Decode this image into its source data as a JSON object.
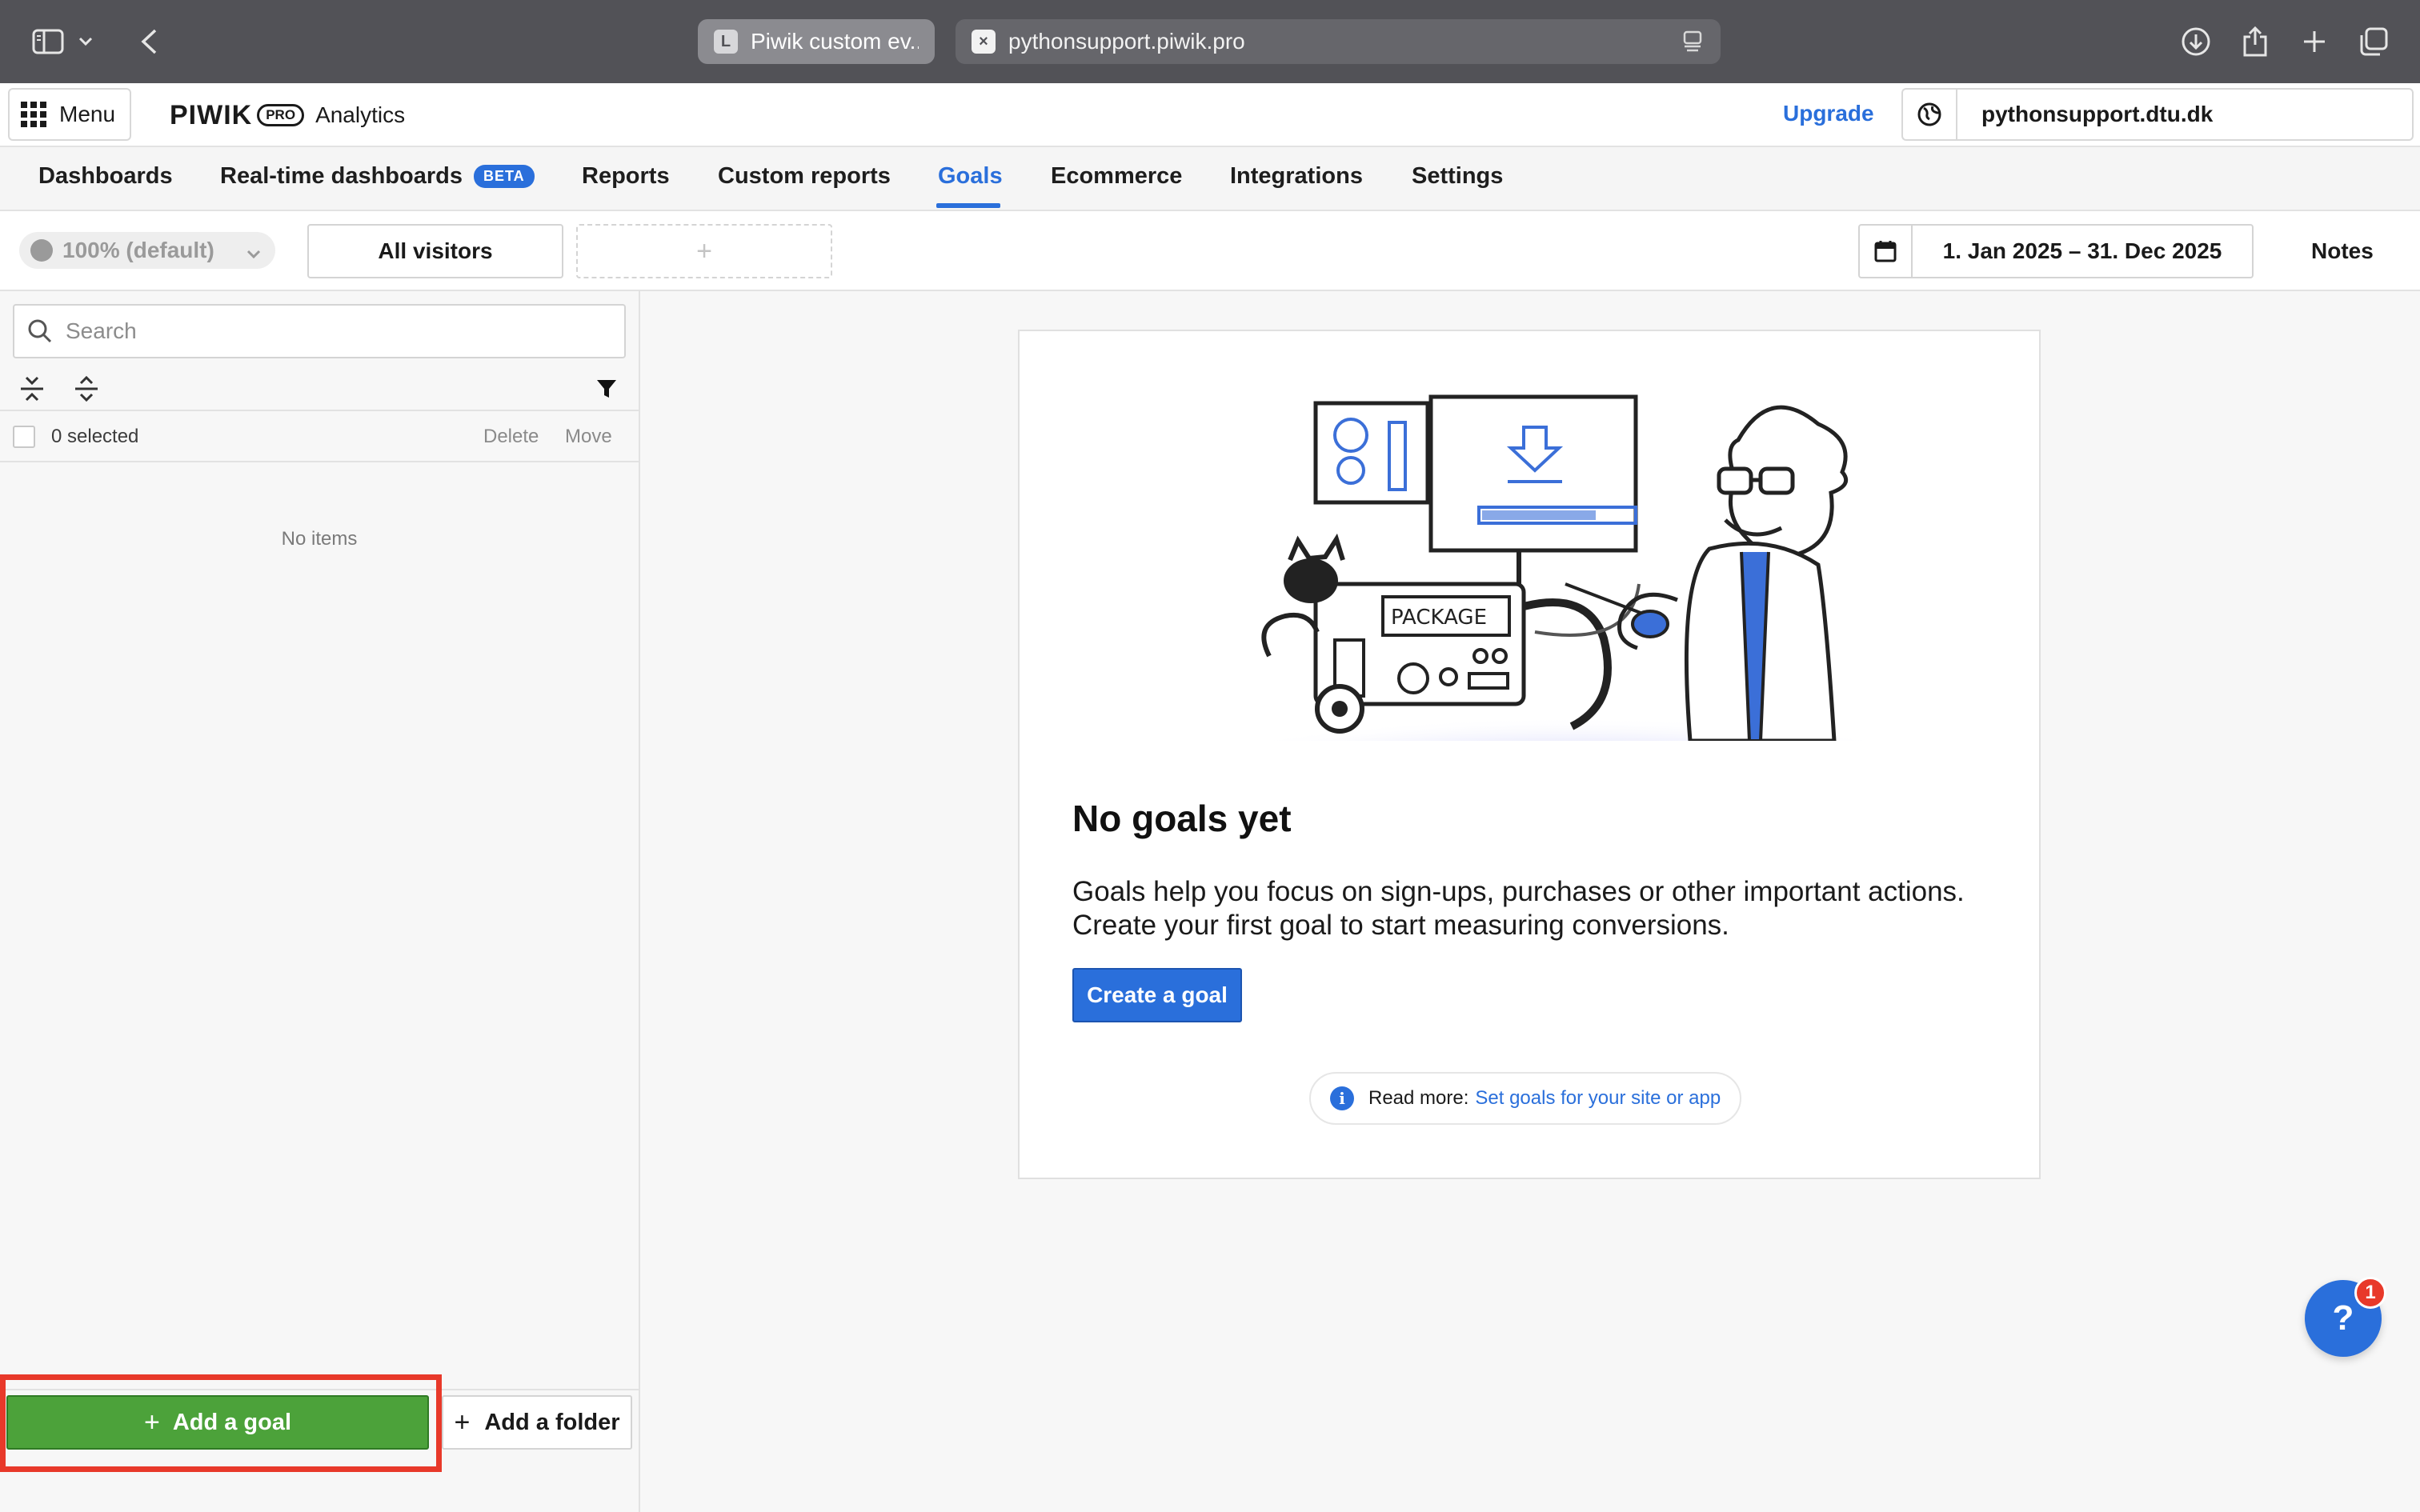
{
  "browser": {
    "tabs": [
      {
        "favicon": "L",
        "title": "Piwik custom ev...",
        "active": true
      },
      {
        "favicon": "×",
        "title": "pythonsupport.piwik.pro",
        "active": false
      }
    ]
  },
  "header": {
    "menu_label": "Menu",
    "logo_text": "PIWIK",
    "logo_badge": "PRO",
    "logo_product": "Analytics",
    "upgrade_label": "Upgrade",
    "site_name": "pythonsupport.dtu.dk"
  },
  "nav": {
    "items": [
      {
        "label": "Dashboards"
      },
      {
        "label": "Real-time dashboards",
        "badge": "BETA"
      },
      {
        "label": "Reports"
      },
      {
        "label": "Custom reports"
      },
      {
        "label": "Goals",
        "active": true
      },
      {
        "label": "Ecommerce"
      },
      {
        "label": "Integrations"
      },
      {
        "label": "Settings"
      }
    ]
  },
  "filters": {
    "sampling": "100% (default)",
    "segment": "All visitors",
    "add_segment": "+",
    "date_range": "1. Jan 2025 – 31. Dec 2025",
    "notes_label": "Notes"
  },
  "sidebar": {
    "search_placeholder": "Search",
    "selected_count": "0 selected",
    "delete_label": "Delete",
    "move_label": "Move",
    "empty_text": "No items",
    "add_goal_label": "Add a goal",
    "add_folder_label": "Add a folder"
  },
  "empty_state": {
    "illustration_text": "PACKAGE",
    "title": "No goals yet",
    "description": "Goals help you focus on sign-ups, purchases or other important actions. Create your first goal to start measuring conversions.",
    "cta_label": "Create a goal",
    "read_more_prefix": "Read more:",
    "read_more_link": "Set goals for your site or app"
  },
  "help": {
    "label": "?",
    "badge_count": "1"
  },
  "colors": {
    "accent": "#2a6fdb",
    "add_goal_green": "#4ca23a",
    "highlight_red": "#e8392a"
  }
}
